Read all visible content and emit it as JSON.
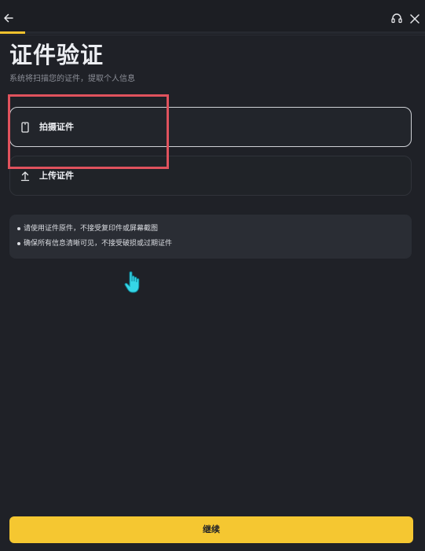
{
  "header": {
    "back_icon": "arrow-left-icon",
    "support_icon": "headset-icon",
    "close_icon": "close-icon",
    "progress": 0.06,
    "accent_color": "#f3c22e"
  },
  "main": {
    "title": "证件验证",
    "subtitle": "系统将扫描您的证件，提取个人信息",
    "options": [
      {
        "label": "拍摄证件",
        "icon": "phone-camera-icon",
        "selected": true
      },
      {
        "label": "上传证件",
        "icon": "upload-icon",
        "selected": false
      }
    ],
    "tips": [
      "请使用证件原件，不接受复印件或屏幕截图",
      "确保所有信息清晰可见，不接受破损或过期证件"
    ]
  },
  "annotation": {
    "highlight_color": "#e0525d"
  },
  "footer": {
    "continue_label": "继续",
    "button_color": "#f5c731"
  }
}
